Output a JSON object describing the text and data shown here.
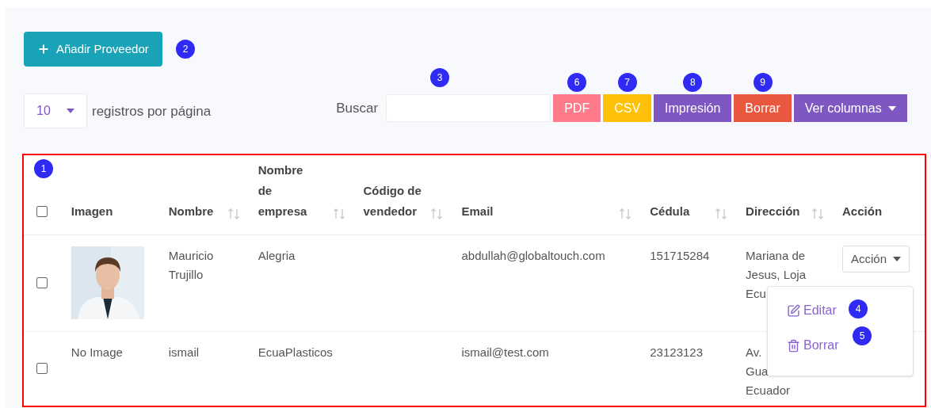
{
  "add_button": {
    "label": "Añadir Proveedor",
    "badge": "2"
  },
  "page_size": {
    "value": "10",
    "label": "registros por página"
  },
  "search": {
    "label": "Buscar",
    "badge": "3"
  },
  "export_buttons": [
    {
      "label": "PDF",
      "color": "#ff7b8b",
      "badge": "6",
      "caret": false
    },
    {
      "label": "CSV",
      "color": "#ffc107",
      "badge": "7",
      "caret": false
    },
    {
      "label": "Impresión",
      "color": "#7e57c2",
      "badge": "8",
      "caret": false
    },
    {
      "label": "Borrar",
      "color": "#ea573f",
      "badge": "9",
      "caret": false
    },
    {
      "label": "Ver columnas",
      "color": "#7e57c2",
      "caret": true
    }
  ],
  "table": {
    "badge": "1",
    "select_all": {
      "checked": false
    },
    "columns": [
      {
        "label": "Imagen",
        "sortable": false
      },
      {
        "label": "Nombre",
        "sortable": true
      },
      {
        "label": "Nombre de empresa",
        "sortable": true
      },
      {
        "label": "Código de vendedor",
        "sortable": true
      },
      {
        "label": "Email",
        "sortable": true
      },
      {
        "label": "Cédula",
        "sortable": true
      },
      {
        "label": "Dirección",
        "sortable": true
      },
      {
        "label": "Acción",
        "sortable": false
      }
    ],
    "rows": [
      {
        "checked": false,
        "name": "Mauricio Trujillo",
        "company": "Alegria",
        "email": "abdullah@globaltouch.com",
        "id": "151715284",
        "address": [
          "Mariana de",
          "Jesus, Loja",
          "Ecu"
        ],
        "action": "Acción"
      },
      {
        "checked": false,
        "image": {
          "kind": "text",
          "text": "No Image"
        },
        "name": "ismail",
        "company": "EcuaPlasticos",
        "email": "ismail@test.com",
        "id": "23123123",
        "address": [
          "Av.",
          "Gua",
          "Ecuador"
        ]
      }
    ]
  },
  "action_menu": {
    "items": [
      {
        "kind": "edit",
        "label": "Editar",
        "badge": "4"
      },
      {
        "kind": "delete",
        "label": "Borrar",
        "badge": "5"
      }
    ]
  }
}
